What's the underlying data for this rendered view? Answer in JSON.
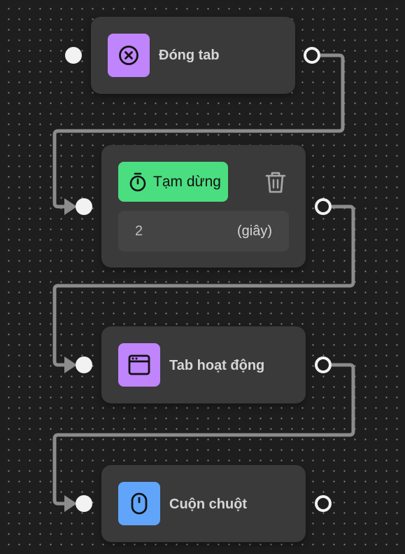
{
  "colors": {
    "canvas_bg": "#1e1e1e",
    "node_bg": "#3a3a3a",
    "connector": "#8c8c8c",
    "purple_accent": "#c084fc",
    "green_accent": "#4ade80",
    "blue_accent": "#60a5fa"
  },
  "flow": {
    "nodes": [
      {
        "label": "Đóng tab",
        "icon": "close-circle-icon"
      },
      {
        "label": "Tạm dừng",
        "icon": "stopwatch-icon",
        "delete_icon": "trash-icon",
        "duration_value": "2",
        "duration_unit": "(giây)"
      },
      {
        "label": "Tab hoạt động",
        "icon": "browser-window-icon"
      },
      {
        "label": "Cuộn chuột",
        "icon": "mouse-icon"
      }
    ]
  }
}
